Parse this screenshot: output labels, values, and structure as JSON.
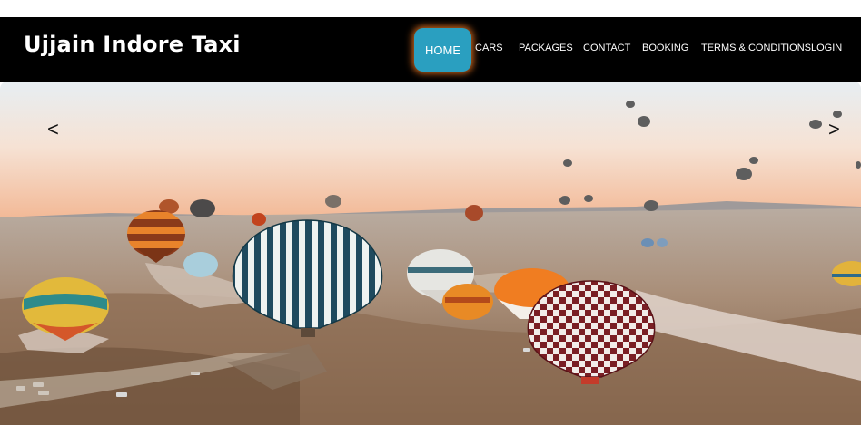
{
  "brand": {
    "title": "Ujjain Indore Taxi"
  },
  "nav": {
    "items": [
      {
        "label": "HOME",
        "active": true
      },
      {
        "label": "CARS"
      },
      {
        "label": "PACKAGES"
      },
      {
        "label": "CONTACT"
      },
      {
        "label": "BOOKING"
      },
      {
        "label": "TERMS & CONDITIONS"
      },
      {
        "label": "LOGIN"
      }
    ]
  },
  "slider": {
    "prev_label": "<",
    "next_label": ">"
  },
  "colors": {
    "navbar_bg": "#000000",
    "active_tab": "#2a9fc0",
    "active_glow": "#d2691e"
  }
}
